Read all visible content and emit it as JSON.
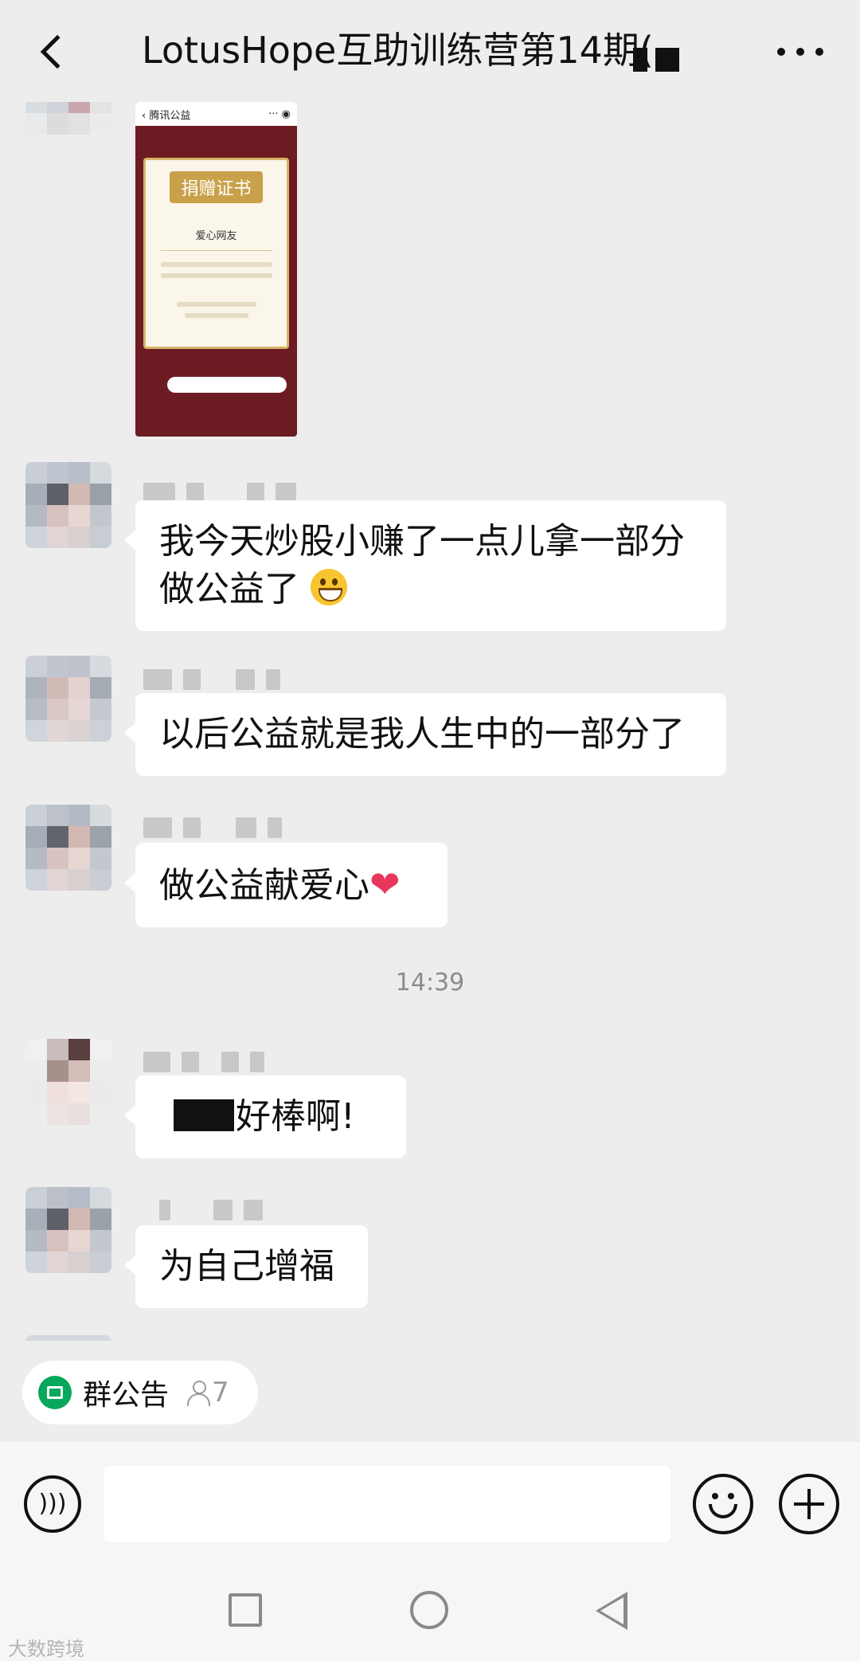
{
  "header": {
    "title": "LotusHope互助训练营第14期("
  },
  "certificate": {
    "app_title": "腾讯公益",
    "heading": "捐赠证书",
    "recipient": "爱心网友"
  },
  "messages": [
    {
      "text": "我今天炒股小赚了一点儿拿一部分",
      "text2": "做公益了"
    },
    {
      "text": "以后公益就是我人生中的一部分了"
    },
    {
      "text": "做公益献爱心"
    },
    {
      "text": "好棒啊!"
    },
    {
      "text": "为自己增福"
    }
  ],
  "time_divider": "14:39",
  "notice": {
    "label": "群公告",
    "member_count": "7"
  },
  "input": {
    "placeholder": ""
  },
  "watermark": "大数跨境"
}
